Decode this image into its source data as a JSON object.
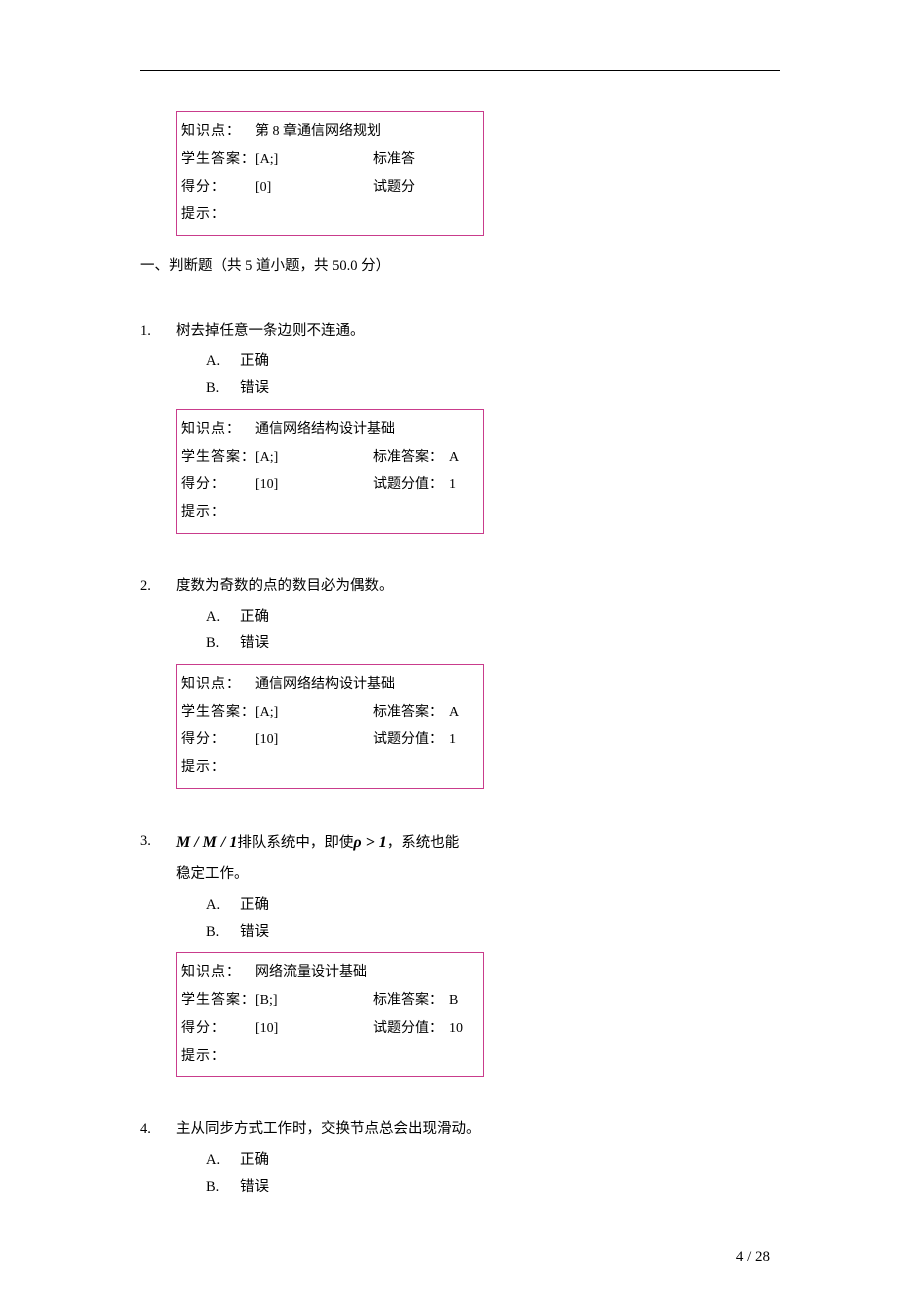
{
  "top_box": {
    "kp_label": "知识点：",
    "kp_value": "第 8 章通信网络规划",
    "stu_label": "学生答案：",
    "stu_value": "[A;]",
    "std_label": "标准答",
    "score_label": "得分：",
    "score_value": "[0]",
    "tiscore_label": "试题分",
    "hint_label": "提示："
  },
  "section_heading": "一、判断题（共 5 道小题，共 50.0 分）",
  "questions": [
    {
      "num": "1.",
      "stem": "树去掉任意一条边则不连通。",
      "opts": [
        {
          "letter": "A.",
          "text": "正确"
        },
        {
          "letter": "B.",
          "text": "错误"
        }
      ],
      "box": {
        "kp_label": "知识点：",
        "kp_value": "通信网络结构设计基础",
        "stu_label": "学生答案：",
        "stu_value": "[A;]",
        "std_label": "标准答案：",
        "std_value": "A",
        "score_label": "得分：",
        "score_value": "[10]",
        "tiscore_label": "试题分值：",
        "tiscore_value": "1",
        "hint_label": "提示："
      }
    },
    {
      "num": "2.",
      "stem": "度数为奇数的点的数目必为偶数。",
      "opts": [
        {
          "letter": "A.",
          "text": "正确"
        },
        {
          "letter": "B.",
          "text": "错误"
        }
      ],
      "box": {
        "kp_label": "知识点：",
        "kp_value": "通信网络结构设计基础",
        "stu_label": "学生答案：",
        "stu_value": "[A;]",
        "std_label": "标准答案：",
        "std_value": "A",
        "score_label": "得分：",
        "score_value": "[10]",
        "tiscore_label": "试题分值：",
        "tiscore_value": "1",
        "hint_label": "提示："
      }
    },
    {
      "num": "3.",
      "stem_pre": "",
      "math1": "M / M / 1",
      "stem_mid": "排队系统中，即使",
      "math2": "ρ > 1",
      "stem_post": "，系统也能",
      "stem_cont": "稳定工作。",
      "opts": [
        {
          "letter": "A.",
          "text": "正确"
        },
        {
          "letter": "B.",
          "text": "错误"
        }
      ],
      "box": {
        "kp_label": "知识点：",
        "kp_value": "网络流量设计基础",
        "stu_label": "学生答案：",
        "stu_value": "[B;]",
        "std_label": "标准答案：",
        "std_value": "B",
        "score_label": "得分：",
        "score_value": "[10]",
        "tiscore_label": "试题分值：",
        "tiscore_value": "10",
        "hint_label": "提示："
      }
    },
    {
      "num": "4.",
      "stem": "主从同步方式工作时，交换节点总会出现滑动。",
      "opts": [
        {
          "letter": "A.",
          "text": "正确"
        },
        {
          "letter": "B.",
          "text": "错误"
        }
      ]
    }
  ],
  "page_number": "4 / 28"
}
